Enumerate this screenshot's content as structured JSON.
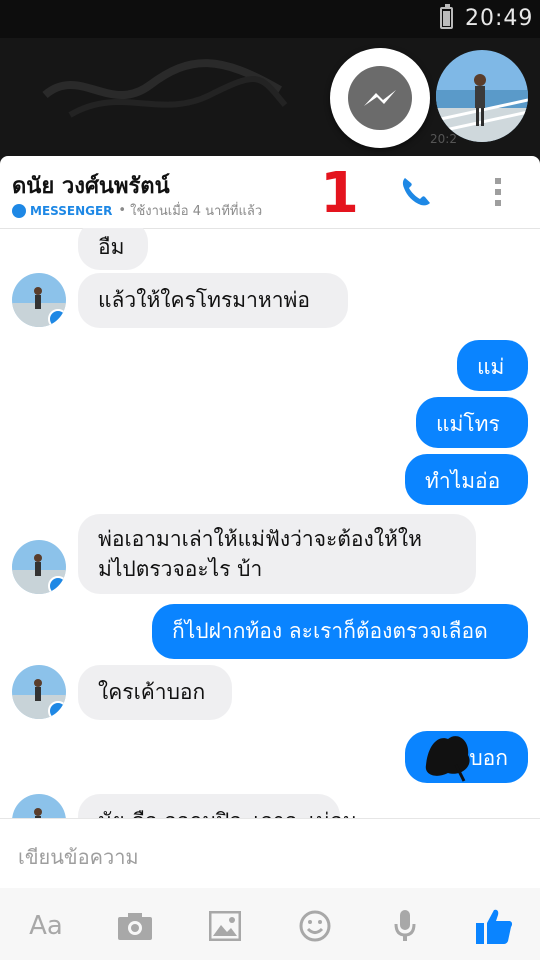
{
  "status_bar": {
    "time": "20:49"
  },
  "chat_head_time": "20:2",
  "header": {
    "contact_name": "ดนัย วงศ์นพรัตน์",
    "app_label": "MESSENGER",
    "separator": "•",
    "active_status": "ใช้งานเมื่อ 4 นาทีที่แล้ว",
    "annotation_number": "1"
  },
  "messages": [
    {
      "side": "in",
      "text": "อืม"
    },
    {
      "side": "in",
      "text": "แล้วให้ใครโทรมาหาพ่อ"
    },
    {
      "side": "out",
      "text": "แม่"
    },
    {
      "side": "out",
      "text": "แม่โทร"
    },
    {
      "side": "out",
      "text": "ทำไมอ่อ"
    },
    {
      "side": "in",
      "text_line1": "พ่อเอามาเล่าให้แม่ฟังว่าจะต้องให้ให",
      "text_line2": "ม่ไปตรวจอะไร บ้า"
    },
    {
      "side": "out",
      "text": "ก็ไปฝากท้อง ละเราก็ต้องตรวจเลือด"
    },
    {
      "side": "in",
      "text": "ใครเค้าบอก"
    },
    {
      "side": "out",
      "text": "บอก"
    },
    {
      "side": "in",
      "text": "นัย ดือ ออกมปิอะเอาอะเน่อน"
    }
  ],
  "composer": {
    "placeholder": "เขียนข้อความ"
  },
  "toolbar": {
    "text_format_label": "Aa"
  },
  "colors": {
    "accent": "#0a84ff",
    "incoming_bubble": "#efeff1",
    "annotation_red": "#e4141e"
  }
}
